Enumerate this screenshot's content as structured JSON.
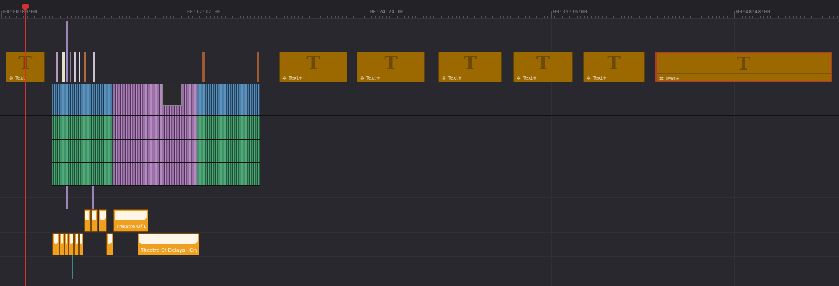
{
  "ruler": {
    "timecodes": [
      "00:00:00:00",
      "00:12:12:00",
      "00:24:24:00",
      "00:36:36:00",
      "00:48:48:00"
    ]
  },
  "title_track": {
    "clips": [
      {
        "label": "Text",
        "glyph": "T",
        "fx": "✲",
        "selected": false
      },
      {
        "label": "Text+",
        "glyph": "T",
        "fx": "✲",
        "selected": false
      },
      {
        "label": "Text+",
        "glyph": "T",
        "fx": "✲",
        "selected": false
      },
      {
        "label": "Text+",
        "glyph": "T",
        "fx": "✲",
        "selected": false
      },
      {
        "label": "Text+",
        "glyph": "T",
        "fx": "✲",
        "selected": false
      },
      {
        "label": "Text+",
        "glyph": "T",
        "fx": "✲",
        "selected": false
      },
      {
        "label": "Text+",
        "glyph": "T",
        "fx": "✲",
        "selected": true
      }
    ]
  },
  "music_track": {
    "clips": [
      {
        "label": "Theatre Of Del..."
      },
      {
        "label": "Theatre Of Delays - Crystal ..."
      }
    ]
  },
  "colors": {
    "text_clip": "#9c6800",
    "video_clip": "#4a7fa8",
    "audio_clip": "#3f9466",
    "compound_clip": "#9c6fa8",
    "music_clip": "#f0a020",
    "playhead": "#d43232",
    "selection": "#b33a2a"
  }
}
